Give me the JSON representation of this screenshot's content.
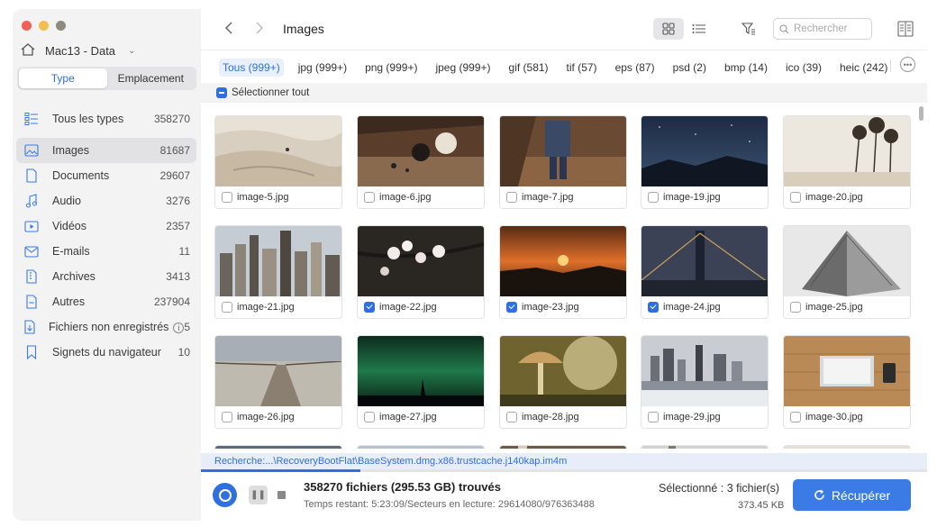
{
  "sidebar": {
    "drive_name": "Mac13 - Data",
    "segments": [
      "Type",
      "Emplacement"
    ],
    "categories": [
      {
        "label": "Tous les types",
        "count": "358270"
      },
      {
        "label": "Images",
        "count": "81687"
      },
      {
        "label": "Documents",
        "count": "29607"
      },
      {
        "label": "Audio",
        "count": "3276"
      },
      {
        "label": "Vidéos",
        "count": "2357"
      },
      {
        "label": "E-mails",
        "count": "11"
      },
      {
        "label": "Archives",
        "count": "3413"
      },
      {
        "label": "Autres",
        "count": "237904"
      },
      {
        "label": "Fichiers non enregistrés",
        "count": "5"
      },
      {
        "label": "Signets du navigateur",
        "count": "10"
      }
    ]
  },
  "header": {
    "title": "Images",
    "search_placeholder": "Rechercher"
  },
  "filters": [
    "Tous (999+)",
    "jpg (999+)",
    "png (999+)",
    "jpeg (999+)",
    "gif (581)",
    "tif (57)",
    "eps (87)",
    "psd (2)",
    "bmp (14)",
    "ico (39)",
    "heic (242)"
  ],
  "select_all_label": "Sélectionner tout",
  "files": [
    {
      "name": "image-5.jpg",
      "checked": false
    },
    {
      "name": "image-6.jpg",
      "checked": false
    },
    {
      "name": "image-7.jpg",
      "checked": false
    },
    {
      "name": "image-19.jpg",
      "checked": false
    },
    {
      "name": "image-20.jpg",
      "checked": false
    },
    {
      "name": "image-21.jpg",
      "checked": false
    },
    {
      "name": "image-22.jpg",
      "checked": true
    },
    {
      "name": "image-23.jpg",
      "checked": true
    },
    {
      "name": "image-24.jpg",
      "checked": true
    },
    {
      "name": "image-25.jpg",
      "checked": false
    },
    {
      "name": "image-26.jpg",
      "checked": false
    },
    {
      "name": "image-27.jpg",
      "checked": false
    },
    {
      "name": "image-28.jpg",
      "checked": false
    },
    {
      "name": "image-29.jpg",
      "checked": false
    },
    {
      "name": "image-30.jpg",
      "checked": false
    }
  ],
  "status": {
    "path": "Recherche:...\\RecoveryBootFlat\\BaseSystem.dmg.x86.trustcache.j140kap.im4m",
    "progress": 0.22,
    "found": "358270 fichiers (295.53 GB) trouvés",
    "remaining": "Temps restant: 5:23:09/Secteurs en lecture: 29614080/976363488",
    "selected": "Sélectionné : 3 fichier(s)",
    "selected_size": "373.45 KB",
    "recover_label": "Récupérer"
  },
  "colors": {
    "accent": "#2f6fe0",
    "button": "#3a7be6"
  }
}
